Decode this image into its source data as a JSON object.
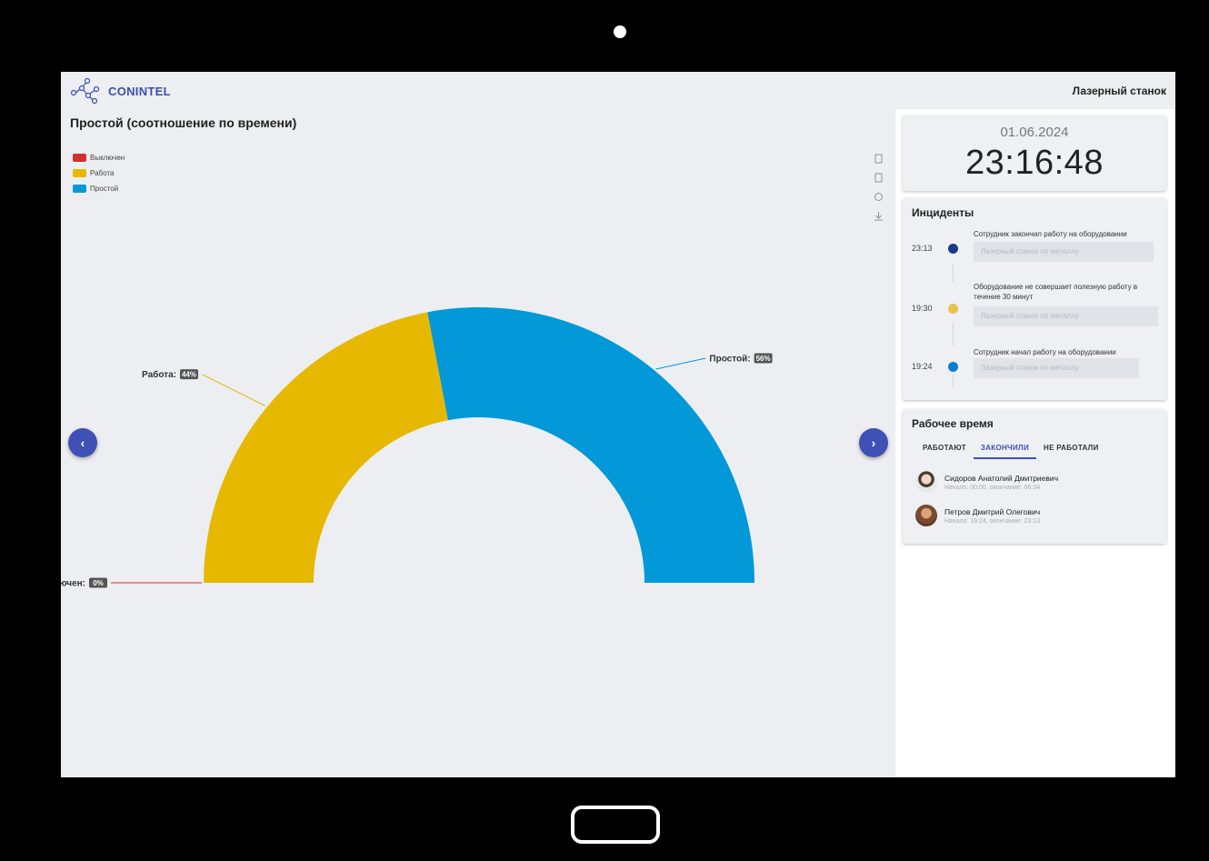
{
  "header": {
    "brand": "CONINTEL",
    "device": "Лазерный станок"
  },
  "chart_section": {
    "title": "Простой (соотношение по времени)",
    "legend": [
      {
        "label": "Выключен",
        "color": "#d32f2f"
      },
      {
        "label": "Работа",
        "color": "#e6b800"
      },
      {
        "label": "Простой",
        "color": "#0398d8"
      }
    ],
    "toolbar_icons": [
      "zoom-in-icon",
      "zoom-out-icon",
      "reset-icon",
      "download-icon"
    ],
    "nav": {
      "prev": "‹",
      "next": "›"
    }
  },
  "chart_data": {
    "type": "pie",
    "variant": "semi-donut",
    "categories": [
      "Выключен",
      "Работа",
      "Простой"
    ],
    "values": [
      0,
      44,
      56
    ],
    "labels": {
      "off": {
        "name": "Выключен:",
        "value": "0%"
      },
      "work": {
        "name": "Работа:",
        "value": "44%"
      },
      "idle": {
        "name": "Простой:",
        "value": "56%"
      }
    },
    "colors": [
      "#d32f2f",
      "#e6b800",
      "#0398d8"
    ]
  },
  "clock": {
    "date": "01.06.2024",
    "time": "23:16:48"
  },
  "incidents": {
    "title": "Инциденты",
    "items": [
      {
        "time": "23:13",
        "text": "Сотрудник закончил работу на оборудовании",
        "device": "Лазерный станок по металлу",
        "color": "#1a3a8a"
      },
      {
        "time": "19:30",
        "text": "Оборудование не совершает полезную работу в течение 30 минут",
        "device": "Лазерный станок по металлу",
        "color": "#e6c34a"
      },
      {
        "time": "19:24",
        "text": "Сотрудник начал работу на оборудовании",
        "device": "Лазерный станок по металлу",
        "color": "#0b7dd1"
      }
    ]
  },
  "work_time": {
    "title": "Рабочее время",
    "tabs": [
      "РАБОТАЮТ",
      "ЗАКОНЧИЛИ",
      "НЕ РАБОТАЛИ"
    ],
    "active_tab": 1,
    "people": [
      {
        "name": "Сидоров Анатолий Дмитриевич",
        "sub": "Начало: 00:00, окончание: 06:34"
      },
      {
        "name": "Петров Дмитрий Олегович",
        "sub": "Начало: 19:24, окончание: 23:13"
      }
    ]
  }
}
